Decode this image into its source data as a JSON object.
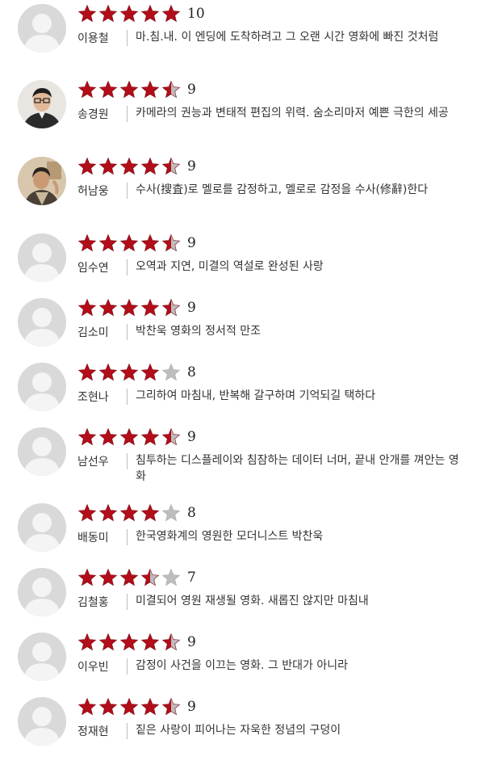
{
  "colors": {
    "star_fill": "#b30d1a",
    "star_empty": "#bdbdbd",
    "separator": "#bdbdbd"
  },
  "reviews": [
    {
      "name": "이용철",
      "score": "10",
      "rating": 5,
      "avatar": "default",
      "comment": "마.침.내. 이 엔딩에 도착하려고 그 오랜 시간 영화에 빠진 것처럼"
    },
    {
      "name": "송경원",
      "score": "9",
      "rating": 4.5,
      "avatar": "photo-man-glasses",
      "comment": "카메라의 권능과 변태적 편집의 위력. 숨소리마저 예쁜 극한의 세공"
    },
    {
      "name": "허남웅",
      "score": "9",
      "rating": 4.5,
      "avatar": "photo-man",
      "comment": "수사(搜査)로 멜로를 감정하고, 멜로로 감정을 수사(修辭)한다"
    },
    {
      "name": "임수연",
      "score": "9",
      "rating": 4.5,
      "avatar": "default",
      "comment": "오역과 지연, 미결의 역설로 완성된 사랑"
    },
    {
      "name": "김소미",
      "score": "9",
      "rating": 4.5,
      "avatar": "default",
      "comment": "박찬욱 영화의 정서적 만조"
    },
    {
      "name": "조현나",
      "score": "8",
      "rating": 4,
      "avatar": "default",
      "comment": "그리하여 마침내, 반복해 갈구하며 기억되길 택하다"
    },
    {
      "name": "남선우",
      "score": "9",
      "rating": 4.5,
      "avatar": "default",
      "comment": "침투하는 디스플레이와 침잠하는 데이터 너머, 끝내 안개를 껴안는 영화"
    },
    {
      "name": "배동미",
      "score": "8",
      "rating": 4,
      "avatar": "default",
      "comment": "한국영화계의 영원한 모더니스트 박찬욱"
    },
    {
      "name": "김철홍",
      "score": "7",
      "rating": 3.5,
      "avatar": "default",
      "comment": "미결되어 영원 재생될 영화. 새롭진 않지만 마침내"
    },
    {
      "name": "이우빈",
      "score": "9",
      "rating": 4.5,
      "avatar": "default",
      "comment": "감정이 사건을 이끄는 영화. 그 반대가 아니라"
    },
    {
      "name": "정재현",
      "score": "9",
      "rating": 4.5,
      "avatar": "default",
      "comment": "짙은 사랑이 피어나는 자욱한 정념의 구덩이"
    }
  ]
}
